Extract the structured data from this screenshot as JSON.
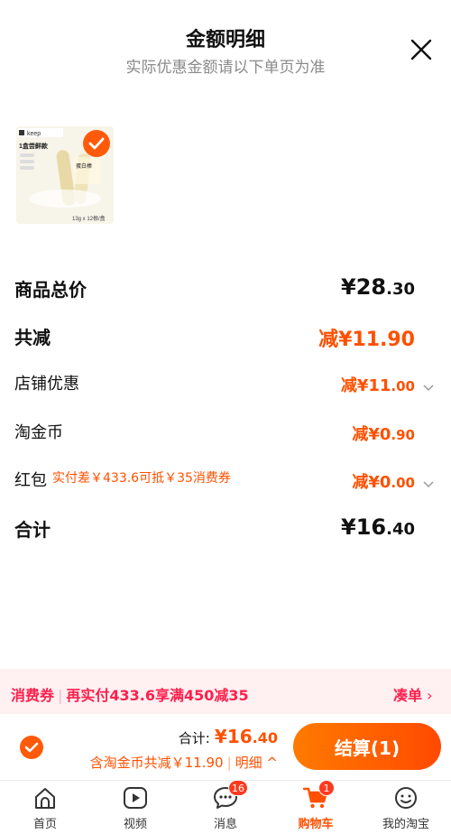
{
  "header": {
    "title": "金额明细",
    "subtitle": "实际优惠金额请以下单页为准"
  },
  "product": {
    "brand": "keep",
    "image_texts": [
      "1盒尝鲜款",
      "13g x 12根/盒",
      "蛋白棒"
    ],
    "selected": true
  },
  "rows": {
    "goods_total": {
      "label": "商品总价",
      "currency": "¥",
      "int": "28",
      "dec": ".30"
    },
    "total_reduce": {
      "label": "共减",
      "prefix": "减¥",
      "int": "11",
      "dec": ".90"
    },
    "shop_discount": {
      "label": "店铺优惠",
      "prefix": "减¥",
      "int": "11",
      "dec": ".00"
    },
    "taojinbi": {
      "label": "淘金币",
      "prefix": "减¥",
      "int": "0",
      "dec": ".90"
    },
    "hongbao": {
      "label": "红包",
      "hint": "实付差￥433.6可抵￥35消费券",
      "prefix": "减¥",
      "int": "0",
      "dec": ".00"
    },
    "sum": {
      "label": "合计",
      "currency": "¥",
      "int": "16",
      "dec": ".40"
    }
  },
  "banner": {
    "tag": "消费券",
    "text": "再实付433.6享满450减35",
    "action": "凑单"
  },
  "action_bar": {
    "total_label": "合计:",
    "total_int": "¥16",
    "total_dec": ".40",
    "deduct_text": "含淘金币共减￥11.90",
    "detail_label": "明细",
    "pay_label": "结算(1)"
  },
  "tabs": [
    {
      "label": "首页",
      "icon": "home-icon"
    },
    {
      "label": "视频",
      "icon": "video-icon"
    },
    {
      "label": "消息",
      "icon": "message-icon",
      "badge": "16"
    },
    {
      "label": "购物车",
      "icon": "cart-icon",
      "badge": "1",
      "active": true
    },
    {
      "label": "我的淘宝",
      "icon": "profile-icon"
    }
  ],
  "colors": {
    "accent": "#ff5000",
    "banner_bg": "#fff0f2",
    "banner_text": "#ff1f4b"
  }
}
